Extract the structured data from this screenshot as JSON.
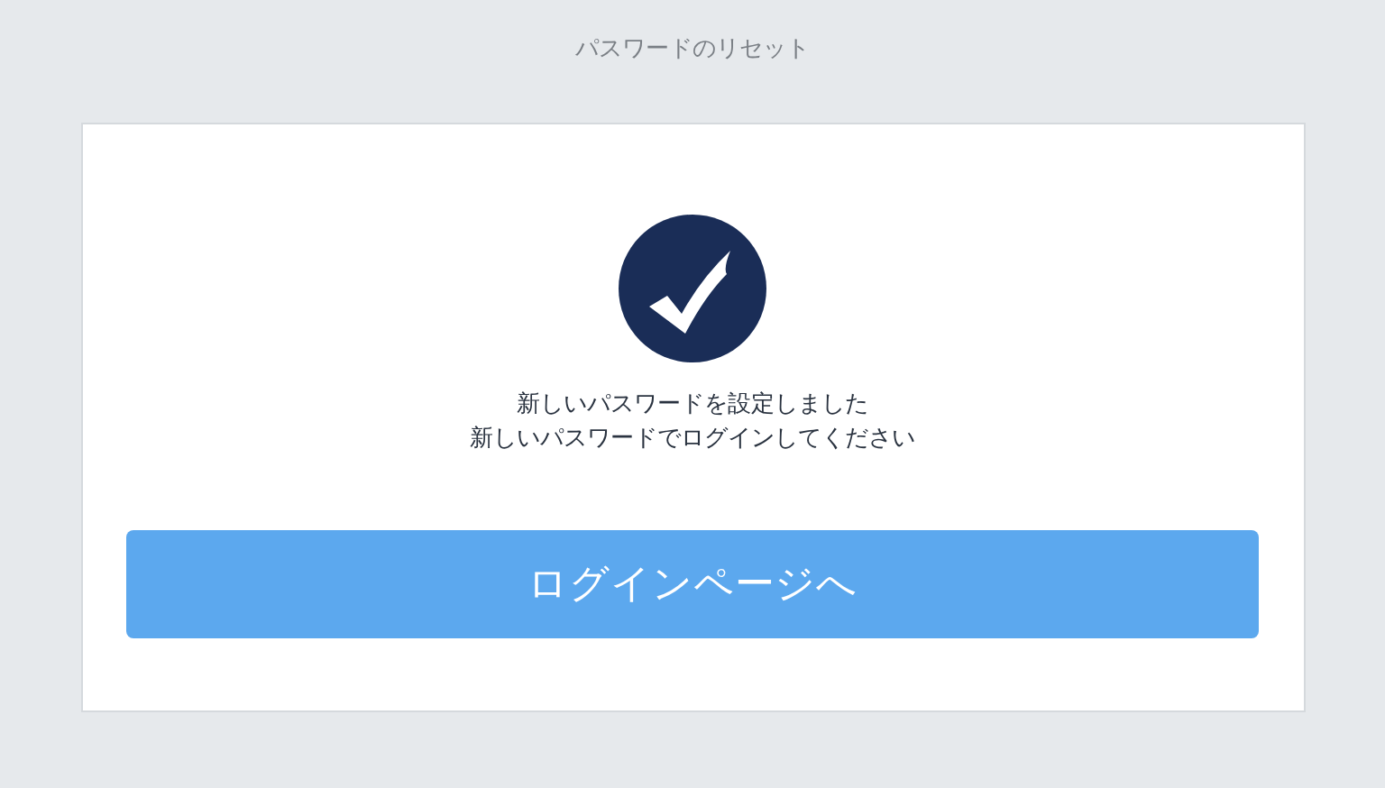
{
  "page_title": "パスワードのリセット",
  "card": {
    "message_lines": [
      "新しいパスワードを設定しました",
      "新しいパスワードでログインしてください"
    ],
    "button": {
      "label": "ログインページへ"
    }
  }
}
